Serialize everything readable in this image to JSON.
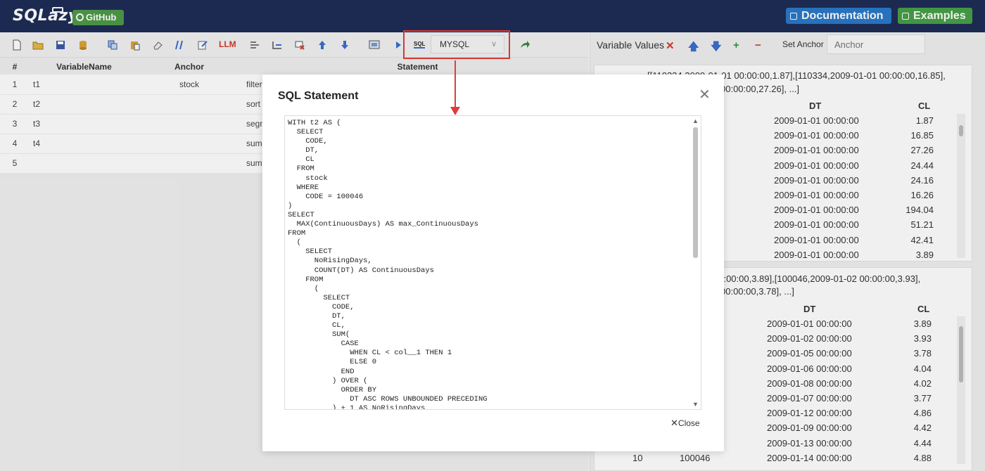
{
  "header": {
    "logo_text": "SQLazy",
    "github_label": "GitHub",
    "documentation_label": "Documentation",
    "examples_label": "Examples"
  },
  "toolbar": {
    "dialect_selected": "MYSQL",
    "sql_icon_label": "SQL",
    "icons": [
      "new-file-icon",
      "open-folder-icon",
      "save-icon",
      "database-icon",
      "copy-icon",
      "paste-icon",
      "eraser-icon",
      "comment-icon",
      "edit-icon",
      "llm-icon",
      "insert-row-icon",
      "add-row-icon",
      "delete-row-icon",
      "move-up-icon",
      "move-down-icon",
      "preview-icon",
      "run-icon",
      "sql-icon",
      "export-arrow-icon"
    ],
    "llm_label": "LLM"
  },
  "grid": {
    "headers": [
      "#",
      "VariableName",
      "Anchor",
      "Statement"
    ],
    "rows": [
      {
        "num": "1",
        "var": "t1",
        "anchor": "stock",
        "stmt": "filter"
      },
      {
        "num": "2",
        "var": "t2",
        "anchor": "",
        "stmt": "sort"
      },
      {
        "num": "3",
        "var": "t3",
        "anchor": "",
        "stmt": "segm"
      },
      {
        "num": "4",
        "var": "t4",
        "anchor": "",
        "stmt": "sum"
      },
      {
        "num": "5",
        "var": "",
        "anchor": "",
        "stmt": "sum"
      }
    ]
  },
  "right_panel": {
    "title": "Variable Values",
    "set_anchor_label": "Set Anchor",
    "anchor_placeholder": "Anchor",
    "card1": {
      "summary_line1": "[[110334,2009-01-01 00:00:00,1.87],[110334,2009-01-01 00:00:00,16.85],",
      "summary_line2": "00:00:00,27.26], ...]",
      "col_dt": "DT",
      "col_cl": "CL",
      "rows": [
        {
          "dt": "2009-01-01 00:00:00",
          "cl": "1.87"
        },
        {
          "dt": "2009-01-01 00:00:00",
          "cl": "16.85"
        },
        {
          "dt": "2009-01-01 00:00:00",
          "cl": "27.26"
        },
        {
          "dt": "2009-01-01 00:00:00",
          "cl": "24.44"
        },
        {
          "dt": "2009-01-01 00:00:00",
          "cl": "24.16"
        },
        {
          "dt": "2009-01-01 00:00:00",
          "cl": "16.26"
        },
        {
          "dt": "2009-01-01 00:00:00",
          "cl": "194.04"
        },
        {
          "dt": "2009-01-01 00:00:00",
          "cl": "51.21"
        },
        {
          "dt": "2009-01-01 00:00:00",
          "cl": "42.41"
        },
        {
          "dt": "2009-01-01 00:00:00",
          "cl": "3.89"
        }
      ]
    },
    "card2": {
      "summary_line1": "00:00:00,3.89],[100046,2009-01-02 00:00:00,3.93],",
      "summary_line2": "00:00:00,3.78], ...]",
      "col_dt": "DT",
      "col_cl": "CL",
      "rows": [
        {
          "dt": "2009-01-01 00:00:00",
          "cl": "3.89"
        },
        {
          "dt": "2009-01-02 00:00:00",
          "cl": "3.93"
        },
        {
          "dt": "2009-01-05 00:00:00",
          "cl": "3.78"
        },
        {
          "dt": "2009-01-06 00:00:00",
          "cl": "4.04"
        },
        {
          "dt": "2009-01-08 00:00:00",
          "cl": "4.02"
        },
        {
          "dt": "2009-01-07 00:00:00",
          "cl": "3.77"
        },
        {
          "dt": "2009-01-12 00:00:00",
          "cl": "4.86"
        },
        {
          "dt": "2009-01-09 00:00:00",
          "cl": "4.42"
        },
        {
          "dt": "2009-01-13 00:00:00",
          "cl": "4.44"
        },
        {
          "dt": "2009-01-14 00:00:00",
          "cl": "4.88"
        }
      ],
      "last_row_num": "10",
      "last_row_code": "100046"
    }
  },
  "modal": {
    "title": "SQL Statement",
    "close_label": "Close",
    "sql": "WITH t2 AS (\n  SELECT\n    CODE,\n    DT,\n    CL\n  FROM\n    stock\n  WHERE\n    CODE = 100046\n)\nSELECT\n  MAX(ContinuousDays) AS max_ContinuousDays\nFROM\n  (\n    SELECT\n      NoRisingDays,\n      COUNT(DT) AS ContinuousDays\n    FROM\n      (\n        SELECT\n          CODE,\n          DT,\n          CL,\n          SUM(\n            CASE\n              WHEN CL < col__1 THEN 1\n              ELSE 0\n            END\n          ) OVER (\n            ORDER BY\n              DT ASC ROWS UNBOUNDED PRECEDING\n          ) + 1 AS NoRisingDays"
  },
  "colors": {
    "header_bg": "#1e2d57",
    "github_green": "#4e9a4a",
    "doc_blue": "#2a79c9",
    "examples_green": "#47a048",
    "highlight_red": "#e03c3c"
  }
}
